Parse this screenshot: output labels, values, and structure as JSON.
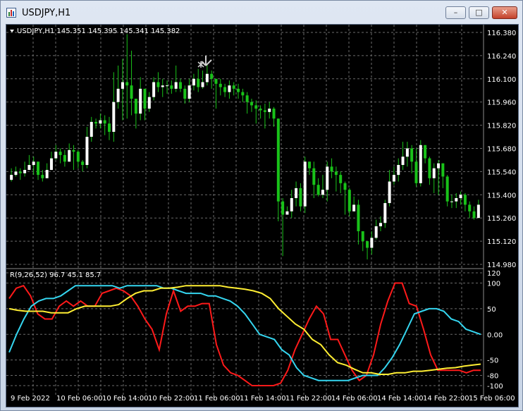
{
  "window": {
    "title": "USDJPY,H1",
    "buttons": [
      "minimize",
      "maximize",
      "close"
    ]
  },
  "colors": {
    "background": "#000000",
    "grid": "#6b6b6b",
    "bull": "#ffffff",
    "bear": "#19c219",
    "red_line": "#ff1a1a",
    "cyan_line": "#35d6f0",
    "yellow_line": "#ffee33",
    "text": "#ffffff"
  },
  "price_chart": {
    "header": "USDJPY,H1  145.351 145.395 145.341 145.382",
    "arrow_icon": "sell-arrow-icon",
    "y_ticks": [
      "116.380",
      "116.240",
      "116.100",
      "115.960",
      "115.820",
      "115.680",
      "115.540",
      "115.400",
      "115.260",
      "115.120",
      "114.980"
    ]
  },
  "indicator": {
    "header": "R(9,26,52) 96.7 45.1 85.7",
    "y_ticks": [
      "120",
      "100",
      "50",
      "0.00",
      "-50",
      "-80",
      "-100"
    ]
  },
  "x_ticks": [
    "9 Feb 2022",
    "10 Feb 06:00",
    "10 Feb 14:00",
    "10 Feb 22:00",
    "11 Feb 06:00",
    "11 Feb 14:00",
    "11 Feb 22:00",
    "14 Feb 06:00",
    "14 Feb 14:00",
    "14 Feb 22:00",
    "15 Feb 06:00"
  ],
  "chart_data": [
    {
      "type": "candlestick",
      "ylim": [
        114.98,
        116.38
      ],
      "x_ticks": [
        "9 Feb 2022",
        "10 Feb 06:00",
        "10 Feb 14:00",
        "10 Feb 22:00",
        "11 Feb 06:00",
        "11 Feb 14:00",
        "11 Feb 22:00",
        "14 Feb 06:00",
        "14 Feb 14:00",
        "14 Feb 22:00",
        "15 Feb 06:00"
      ],
      "close": [
        115.52,
        115.54,
        115.53,
        115.55,
        115.58,
        115.6,
        115.52,
        115.5,
        115.55,
        115.62,
        115.66,
        115.64,
        115.6,
        115.67,
        115.66,
        115.6,
        115.58,
        115.75,
        115.84,
        115.83,
        115.85,
        115.83,
        115.78,
        115.96,
        116.04,
        116.08,
        116.06,
        115.98,
        115.89,
        116.04,
        115.92,
        115.99,
        116.08,
        116.05,
        116.06,
        116.06,
        116.04,
        116.08,
        116.04,
        115.98,
        116.06,
        116.1,
        116.05,
        116.08,
        116.13,
        116.1,
        116.07,
        116.05,
        116.02,
        116.06,
        116.04,
        116.02,
        116.0,
        115.96,
        115.94,
        115.92,
        115.91,
        115.9,
        115.92,
        115.86,
        115.36,
        115.28,
        115.3,
        115.38,
        115.44,
        115.33,
        115.6,
        115.56,
        115.46,
        115.4,
        115.43,
        115.57,
        115.54,
        115.52,
        115.47,
        115.43,
        115.3,
        115.34,
        115.18,
        115.12,
        115.08,
        115.14,
        115.21,
        115.23,
        115.35,
        115.48,
        115.52,
        115.58,
        115.63,
        115.68,
        115.6,
        115.47,
        115.7,
        115.62,
        115.5,
        115.56,
        115.59,
        115.51,
        115.36,
        115.36,
        115.38,
        115.4,
        115.34,
        115.3,
        115.26,
        115.34
      ],
      "high": [
        115.56,
        115.57,
        115.56,
        115.6,
        115.64,
        115.63,
        115.57,
        115.55,
        115.59,
        115.66,
        115.7,
        115.68,
        115.67,
        115.71,
        115.7,
        115.67,
        115.61,
        115.81,
        115.87,
        115.86,
        115.89,
        115.88,
        115.87,
        116.14,
        116.18,
        116.22,
        116.37,
        116.27,
        115.96,
        116.11,
        116.0,
        116.02,
        116.11,
        116.14,
        116.1,
        116.09,
        116.09,
        116.18,
        116.1,
        116.06,
        116.1,
        116.13,
        116.16,
        116.15,
        116.19,
        116.15,
        116.1,
        116.1,
        116.07,
        116.09,
        116.08,
        116.07,
        116.04,
        116.02,
        115.98,
        115.97,
        115.94,
        115.95,
        115.96,
        115.93,
        115.85,
        115.38,
        115.33,
        115.43,
        115.48,
        115.47,
        115.63,
        115.6,
        115.6,
        115.5,
        115.52,
        115.6,
        115.62,
        115.57,
        115.54,
        115.48,
        115.44,
        115.39,
        115.37,
        115.14,
        115.12,
        115.18,
        115.25,
        115.27,
        115.37,
        115.55,
        115.57,
        115.62,
        115.72,
        115.72,
        115.7,
        115.68,
        115.73,
        115.7,
        115.63,
        115.59,
        115.61,
        115.59,
        115.52,
        115.4,
        115.41,
        115.42,
        115.41,
        115.36,
        115.33,
        115.37
      ],
      "low": [
        115.48,
        115.51,
        115.49,
        115.51,
        115.55,
        115.52,
        115.49,
        115.48,
        115.5,
        115.58,
        115.61,
        115.59,
        115.57,
        115.61,
        115.55,
        115.56,
        115.54,
        115.56,
        115.72,
        115.8,
        115.8,
        115.76,
        115.73,
        115.72,
        115.92,
        115.85,
        115.86,
        115.88,
        115.8,
        115.85,
        115.85,
        115.9,
        115.97,
        116.02,
        115.99,
        116.01,
        116.01,
        116.02,
        116.02,
        115.95,
        115.96,
        116.03,
        116.02,
        116.04,
        116.06,
        116.04,
        115.92,
        116.0,
        115.99,
        115.98,
        116.0,
        115.98,
        115.96,
        115.89,
        115.9,
        115.83,
        115.86,
        115.8,
        115.86,
        115.81,
        115.24,
        115.03,
        115.28,
        115.26,
        115.33,
        115.3,
        115.29,
        115.52,
        115.38,
        115.39,
        115.38,
        115.36,
        115.5,
        115.42,
        115.41,
        115.28,
        115.27,
        115.3,
        115.1,
        115.06,
        115.01,
        115.04,
        115.13,
        115.18,
        115.2,
        115.33,
        115.46,
        115.48,
        115.55,
        115.57,
        115.53,
        115.45,
        115.45,
        115.59,
        115.46,
        115.41,
        115.4,
        115.44,
        115.33,
        115.32,
        115.32,
        115.34,
        115.3,
        115.26,
        115.25,
        115.26
      ]
    },
    {
      "type": "line",
      "ylim": [
        -100,
        120
      ],
      "series": [
        {
          "color": "#ff1a1a",
          "values": [
            70,
            90,
            95,
            75,
            40,
            30,
            30,
            55,
            65,
            55,
            65,
            55,
            55,
            80,
            85,
            90,
            85,
            75,
            55,
            30,
            10,
            -30,
            40,
            85,
            45,
            55,
            55,
            60,
            60,
            -20,
            -60,
            -75,
            -80,
            -90,
            -100,
            -100,
            -100,
            -100,
            -95,
            -70,
            -30,
            0,
            30,
            55,
            40,
            -10,
            -10,
            -40,
            -70,
            -90,
            -80,
            -40,
            20,
            65,
            100,
            100,
            60,
            55,
            10,
            -40,
            -70,
            -70,
            -70,
            -70,
            -75,
            -70,
            -70
          ]
        },
        {
          "color": "#35d6f0",
          "values": [
            -35,
            0,
            30,
            55,
            65,
            70,
            70,
            75,
            85,
            95,
            95,
            95,
            95,
            95,
            95,
            90,
            95,
            95,
            95,
            95,
            95,
            90,
            90,
            85,
            80,
            80,
            80,
            75,
            75,
            70,
            65,
            55,
            40,
            20,
            0,
            -5,
            -10,
            -30,
            -40,
            -65,
            -80,
            -85,
            -90,
            -90,
            -90,
            -90,
            -90,
            -85,
            -80,
            -80,
            -80,
            -65,
            -45,
            -20,
            10,
            40,
            45,
            50,
            50,
            45,
            30,
            25,
            10,
            5,
            0
          ]
        },
        {
          "color": "#ffee33",
          "values": [
            50,
            47,
            45,
            45,
            45,
            42,
            42,
            42,
            50,
            55,
            55,
            55,
            55,
            58,
            70,
            80,
            85,
            85,
            90,
            90,
            92,
            95,
            95,
            95,
            95,
            95,
            92,
            90,
            88,
            85,
            80,
            70,
            50,
            35,
            20,
            10,
            -10,
            -20,
            -40,
            -55,
            -60,
            -68,
            -75,
            -75,
            -78,
            -78,
            -75,
            -75,
            -72,
            -72,
            -70,
            -68,
            -66,
            -65,
            -62,
            -60,
            -58
          ]
        }
      ]
    }
  ]
}
